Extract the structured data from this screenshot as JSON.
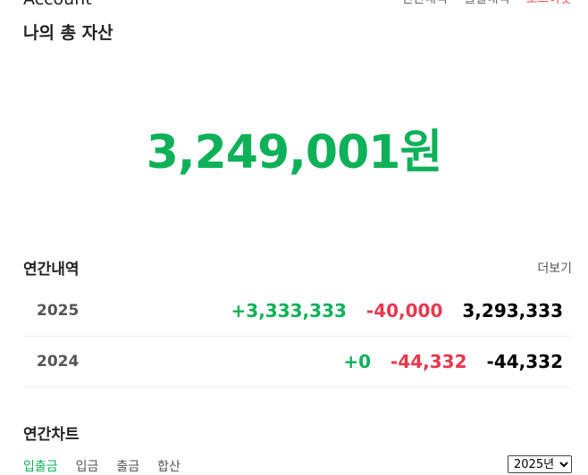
{
  "header": {
    "app_title": "Account",
    "nav": [
      "연간내역",
      "월별내역",
      "로그아웃"
    ]
  },
  "assets": {
    "title": "나의 총 자산",
    "total": "3,249,001원"
  },
  "yearly": {
    "title": "연간내역",
    "more_label": "더보기",
    "rows": [
      {
        "year": "2025",
        "income": "+3,333,333",
        "expense": "-40,000",
        "net": "3,293,333"
      },
      {
        "year": "2024",
        "income": "+0",
        "expense": "-44,332",
        "net": "-44,332"
      }
    ]
  },
  "chart": {
    "title": "연간차트",
    "tabs": [
      "입출금",
      "입금",
      "출금",
      "합산"
    ],
    "active_tab": "입출금",
    "year_select": "2025년"
  },
  "colors": {
    "income": "#0eb158",
    "expense": "#e8374d",
    "accent": "#0eb158"
  }
}
